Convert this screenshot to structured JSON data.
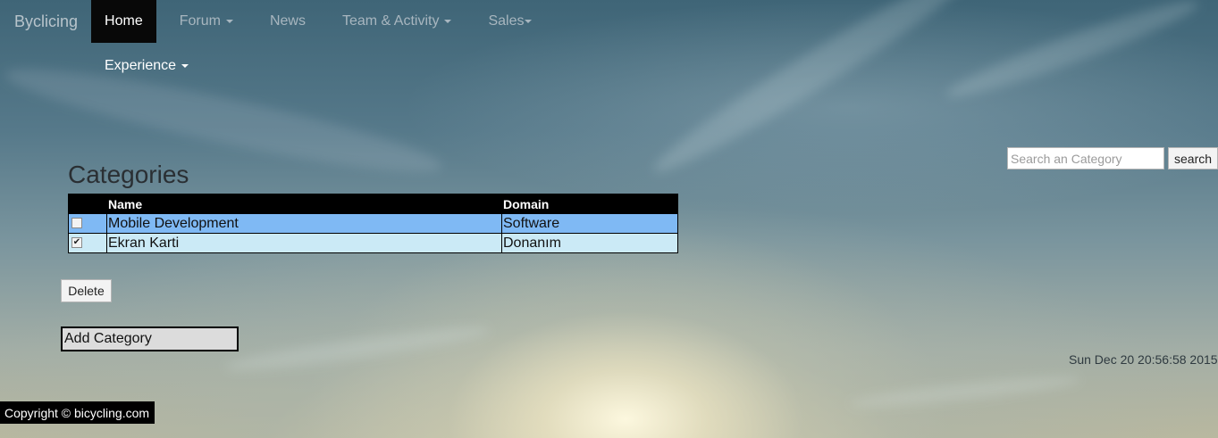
{
  "navbar": {
    "brand": "Byclicing",
    "items": [
      {
        "label": "Home",
        "active": true,
        "dropdown": false
      },
      {
        "label": "Forum",
        "active": false,
        "dropdown": true
      },
      {
        "label": "News",
        "active": false,
        "dropdown": false
      },
      {
        "label": "Team & Activity",
        "active": false,
        "dropdown": true
      },
      {
        "label": "Sales",
        "active": false,
        "dropdown": true
      },
      {
        "label": "Experience",
        "active": false,
        "dropdown": true
      }
    ]
  },
  "search": {
    "placeholder": "Search an Category",
    "value": "",
    "button_label": "search"
  },
  "page": {
    "title": "Categories"
  },
  "table": {
    "columns": [
      "",
      "Name",
      "Domain"
    ],
    "rows": [
      {
        "checked": false,
        "name": "Mobile Development",
        "domain": "Software"
      },
      {
        "checked": true,
        "name": "Ekran Karti",
        "domain": "Donanım"
      }
    ]
  },
  "actions": {
    "delete_label": "Delete",
    "add_label": "Add Category"
  },
  "datetime": "Sun Dec 20 20:56:58 2015",
  "footer": {
    "copyright": "Copyright © bicycling.com"
  },
  "colors": {
    "navbar_active_bg": "#080808",
    "table_header_bg": "#000000",
    "row_1_bg": "#7fb9f4",
    "row_2_bg": "#cbeaf6",
    "footer_bg": "#000000"
  },
  "icons": {
    "dropdown": "caret-down-icon",
    "checkbox_checked": "checkmark-icon"
  }
}
